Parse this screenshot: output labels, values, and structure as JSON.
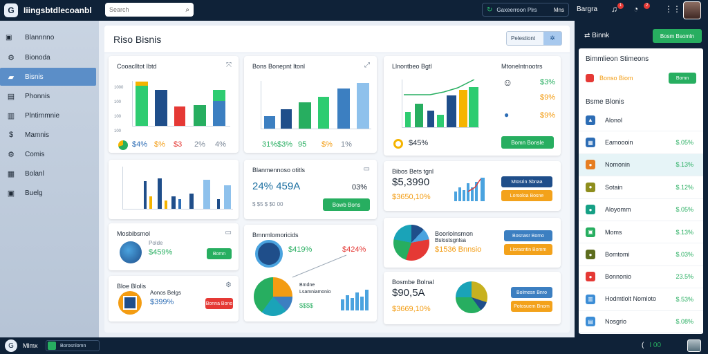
{
  "app": {
    "title": "Iiingsbtdlecoanbl",
    "logo": "G"
  },
  "topbar": {
    "search_placeholder": "Search",
    "filter_label": "Gaxeerroon Plrs",
    "filter_right": "Mns",
    "right_label": "Bargra",
    "notif_count_1": "1",
    "notif_count_2": "2"
  },
  "sidebar": {
    "header": "Blannnno",
    "items": [
      {
        "label": "Bionoda",
        "icon": "gear-icon",
        "glyph": "⚙"
      },
      {
        "label": "Bisnis",
        "icon": "folder-icon",
        "glyph": "▰"
      },
      {
        "label": "Phonnis",
        "icon": "list-icon",
        "glyph": "▤"
      },
      {
        "label": "Plntirnmnie",
        "icon": "document-icon",
        "glyph": "▥"
      },
      {
        "label": "Mamnis",
        "icon": "dollar-icon",
        "glyph": "$"
      },
      {
        "label": "Comis",
        "icon": "settings-icon",
        "glyph": "⚙"
      },
      {
        "label": "Bolanl",
        "icon": "calendar-icon",
        "glyph": "▦"
      },
      {
        "label": "Buelg",
        "icon": "clipboard-icon",
        "glyph": "▣"
      }
    ]
  },
  "main": {
    "title": "Riso Bisnis",
    "header_button": "Pelestiont",
    "header_button_icon": "settings-icon"
  },
  "cards": {
    "c1": {
      "title": "Cooaclltot Ibtd",
      "stats": [
        "$4%",
        "$%",
        "$3",
        "2%",
        "4%"
      ],
      "axis": [
        "1000",
        "100",
        "100",
        "100"
      ]
    },
    "c2": {
      "title": "Bons Bonepnt Itonl",
      "stats": [
        "31%",
        "$3%",
        "95",
        "$%",
        "1%"
      ]
    },
    "c3": {
      "title": "Llnontbeo Bgtl",
      "right_title": "Mtonelntnootrs",
      "stats": [
        "$3%",
        "$9%",
        "$9%"
      ],
      "bottom_stat": "$45%",
      "button": "Bomn Bonsle"
    },
    "c4": {
      "title": "Blanmennoso otitls",
      "big": "24% 459A",
      "right": "03%",
      "sub": "$ $5 $ $0 00",
      "button": "Bowb Bons"
    },
    "c5": {
      "title": "Bibos Bets tgnl",
      "big": "$5,3990",
      "sub": "$3650,10%",
      "btn1": "Mtosrin Sbnaa",
      "btn2": "Lorsoloa Bosne"
    },
    "c6": {
      "title": "Mosbibsmol",
      "line1": "Polde",
      "value": "$459%",
      "button": "Bomn"
    },
    "c7": {
      "title": "Bmnmlomoricids",
      "left_value": "$419%",
      "right_value": "$424%",
      "sub1": "Bmdne",
      "sub2": "Lsamniamonio",
      "sub3": "$$$$"
    },
    "c8": {
      "title": "Boorlolnsmon",
      "line1": "Bslostsgnlsa",
      "value": "$1536 Bnnsio",
      "btn1": "Bosnasr Bomo",
      "btn2": "Liorasntin Bomm"
    },
    "c9": {
      "title": "Bloe Blolis",
      "line1": "Aonos Belgs",
      "value": "$399%",
      "button": "Bonna Bono"
    },
    "c10": {
      "title": "Bosmbe Bolnal",
      "big": "$90,5A",
      "sub": "$3669,10%",
      "btn1": "Bolmesn Bnro",
      "btn2": "Potosuem Bnom"
    }
  },
  "right_panel": {
    "title": "Binnk",
    "button": "Bosm Bsomln",
    "section1_title": "Bimmlieon Stimeons",
    "row1_label": "Bonso Biom",
    "row1_button": "Bomn",
    "section2_title": "Bsme Blonis",
    "items": [
      {
        "label": "Alonol",
        "value": "",
        "color": "#2d6db5",
        "glyph": "▲"
      },
      {
        "label": "Eamoooin",
        "value": "$.05%",
        "color": "#2d6db5",
        "glyph": "▦"
      },
      {
        "label": "Nomonin",
        "value": "$.13%",
        "color": "#e67e22",
        "glyph": "●"
      },
      {
        "label": "Sotain",
        "value": "$.12%",
        "color": "#8e8e1e",
        "glyph": "●"
      },
      {
        "label": "Aloyomm",
        "value": "$.05%",
        "color": "#16a085",
        "glyph": "●"
      },
      {
        "label": "Moms",
        "value": "$.13%",
        "color": "#27ae60",
        "glyph": "▣"
      },
      {
        "label": "Bomtomi",
        "value": "$.03%",
        "color": "#5d6d1e",
        "glyph": "●"
      },
      {
        "label": "Bonnonio",
        "value": "23.5%",
        "color": "#e53935",
        "glyph": "●"
      },
      {
        "label": "Hodmtlolt Nomloto",
        "value": "$.53%",
        "color": "#3c8dd6",
        "glyph": "▥"
      },
      {
        "label": "Nosgrio",
        "value": "$.08%",
        "color": "#3c8dd6",
        "glyph": "▤"
      }
    ]
  },
  "bottombar": {
    "label": "Mlmx",
    "chip": "Borosnlomn",
    "right_text": "(",
    "right_num": "I 00"
  }
}
